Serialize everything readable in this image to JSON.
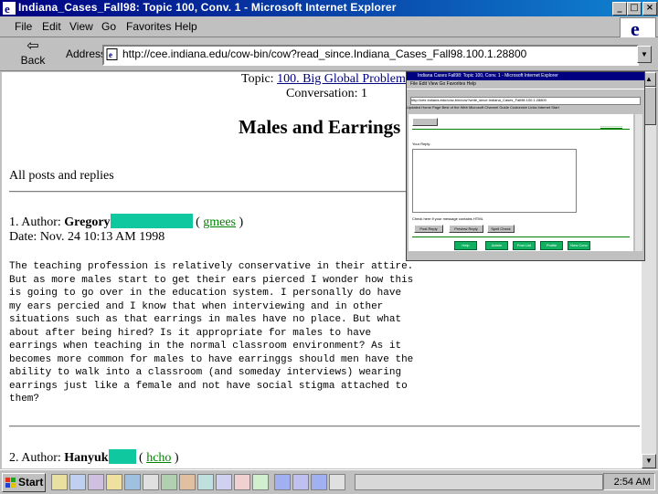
{
  "window": {
    "title": "Indiana_Cases_Fall98: Topic 100, Conv. 1 - Microsoft Internet Explorer",
    "controls": [
      "_",
      "□",
      "×"
    ]
  },
  "menu": [
    "File",
    "Edit",
    "View",
    "Go",
    "Favorites",
    "Help"
  ],
  "toolbar": {
    "back_label": "Back",
    "address_label": "Address",
    "address_value": "http://cee.indiana.edu/cow-bin/cow?read_since.Indiana_Cases_Fall98.100.1.28800"
  },
  "page": {
    "topic_prefix": "Topic:",
    "topic_link": "100. Big Global Problems",
    "conversation": "Conversation: 1",
    "heading": "Males and Earrings",
    "all_posts": "All posts and replies",
    "post1": {
      "number": "1. Author:",
      "author": "Gregory",
      "link": "gmees",
      "date": "Date: Nov. 24 10:13 AM 1998",
      "body": "The teaching profession is relatively conservative in their attire.\nBut as more males start to get their ears pierced I wonder how this\nis going to go over in the education system. I personally do have\nmy ears percied and I know that when interviewing and in other\nsituations such as that earrings in males have no place. But what\nabout after being hired? Is it appropriate for males to have\nearrings when teaching in the normal classroom environment? As it\nbecomes more common for males to have earringgs should men have the\nability to walk into a classroom (and someday interviews) wearing\nearrings just like a female and not have social stigma attached to\nthem?"
    },
    "post2": {
      "number": "2. Author:",
      "author": "Hanyuk",
      "link": "hcho"
    }
  },
  "inset": {
    "title": "Indiana Cases Fall98: Topic 100, Conv. 1 - Microsoft Internet Explorer",
    "menu": "File  Edit  View  Go  Favorites  Help",
    "address": "http://cee.indiana.edu/cow-bin/cow?write_since.Indiana_Cases_Fall98.100.1.28800",
    "links": "Updated Home Page   Best of the Web   Microsoft   Channel Guide   Customize Links   Internet Start",
    "reply_label": "Your Reply",
    "checkbox_label": "Check here if your message contains HTML",
    "buttons": [
      "Post Reply",
      "Preview Reply",
      "Spell Check"
    ],
    "nav_buttons": [
      "Help",
      "Admin",
      "Post List",
      "Profile",
      "New Conv"
    ]
  },
  "taskbar": {
    "start_label": "Start",
    "clock": "2:54 AM"
  },
  "colors": {
    "title_bar": "#000080",
    "redaction": "#10c8a0",
    "link_green": "#008000",
    "link_blue": "#000080"
  }
}
